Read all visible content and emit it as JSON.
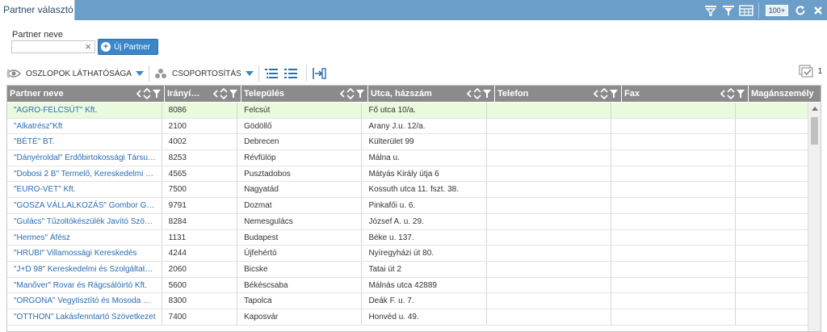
{
  "window": {
    "tab_title": "Partner választó",
    "page_size_badge": "100+",
    "icons": [
      "filter-clear-icon",
      "filter-icon",
      "grid-settings-icon",
      "refresh-icon",
      "close-icon"
    ]
  },
  "filter": {
    "label": "Partner neve",
    "value": "",
    "clear_symbol": "×",
    "new_button_label": "Új Partner",
    "new_button_plus": "+"
  },
  "toolbar": {
    "column_visibility_label": "OSZLOPOK LÁTHATÓSÁGA",
    "grouping_label": "CSOPORTOSÍTÁS",
    "record_count": "1"
  },
  "grid": {
    "columns": [
      "Partner neve",
      "Irányí…",
      "Település",
      "Utca, házszám",
      "Telefon",
      "Fax",
      "Magánszemély"
    ],
    "rows": [
      [
        "\"AGRO-FELCSÚT\" Kft.",
        "8086",
        "Felcsút",
        "Fő utca 10/a.",
        "",
        "",
        ""
      ],
      [
        "\"Alkatrész\"Kft",
        "2100",
        "Gödöllő",
        "Arany J.u. 12/a.",
        "",
        "",
        ""
      ],
      [
        "\"BÉTÉ\" BT.",
        "4002",
        "Debrecen",
        "Külterület 99",
        "",
        "",
        ""
      ],
      [
        "\"Dányéroldal\" Erdőbirtokossági Társu…",
        "8253",
        "Révfülöp",
        "Málna u.",
        "",
        "",
        ""
      ],
      [
        "\"Dobosi 2 B\" Termelő, Kereskedelmi …",
        "4565",
        "Pusztadobos",
        "Mátyás Király útja 6",
        "",
        "",
        ""
      ],
      [
        "\"EURO-VET\" Kft.",
        "7500",
        "Nagyatád",
        "Kossuth utca 11. fszt. 38.",
        "",
        "",
        ""
      ],
      [
        "\"GOSZA VÁLLALKOZÁS\" Gombor G…",
        "9791",
        "Dozmat",
        "Pinkafői u. 6.",
        "",
        "",
        ""
      ],
      [
        "\"Gulács\" Tűzoltókészülék Javító Szö…",
        "8284",
        "Nemesgulács",
        "József A. u. 29.",
        "",
        "",
        ""
      ],
      [
        "\"Hermes\" Áfész",
        "1131",
        "Budapest",
        "Béke u. 137.",
        "",
        "",
        ""
      ],
      [
        "\"HRUBI\" Villamossági Kereskedés",
        "4244",
        "Újfehértó",
        "Nyíregyházi út 80.",
        "",
        "",
        ""
      ],
      [
        "\"J+D 98\" Kereskedelmi és Szolgáltat…",
        "2060",
        "Bicske",
        "Tatai út 2",
        "",
        "",
        ""
      ],
      [
        "\"Manőver\" Rovar és Rágcsálóirtó Kft.",
        "5600",
        "Békéscsaba",
        "Málnás utca 42889",
        "",
        "",
        ""
      ],
      [
        "\"ORGONA\" Vegytisztító és Mosoda …",
        "8300",
        "Tapolca",
        "Deák F. u. 7.",
        "",
        "",
        ""
      ],
      [
        "\"OTTHON\" Lakásfenntartó Szövetkezet",
        "7400",
        "Kaposvár",
        "Honvéd u. 49.",
        "",
        "",
        ""
      ]
    ]
  },
  "colors": {
    "title_bar": "#6b9ec9",
    "header_bg": "#8b8b8b",
    "selected_row": "#e9fadd",
    "accent": "#3a86c8",
    "link_text": "#2a6db3"
  }
}
